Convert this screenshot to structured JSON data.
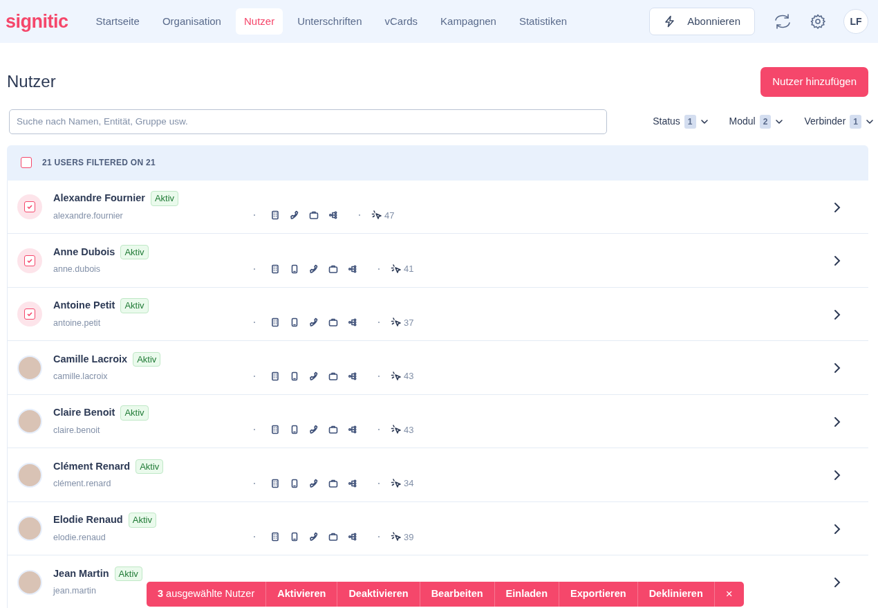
{
  "logo": "signitic",
  "nav_tabs": [
    {
      "label": "Startseite",
      "selected": false
    },
    {
      "label": "Organisation",
      "selected": false
    },
    {
      "label": "Nutzer",
      "selected": true
    },
    {
      "label": "Unterschriften",
      "selected": false
    },
    {
      "label": "vCards",
      "selected": false
    },
    {
      "label": "Kampagnen",
      "selected": false
    },
    {
      "label": "Statistiken",
      "selected": false
    }
  ],
  "subscribe_button": "Abonnieren",
  "user_avatar": "LF",
  "page_title": "Nutzer",
  "add_button": "Nutzer hinzufügen",
  "search": {
    "placeholder": "Suche nach Namen, Entität, Gruppe usw."
  },
  "filters": [
    {
      "label": "Status",
      "count": "1"
    },
    {
      "label": "Modul",
      "count": "2"
    },
    {
      "label": "Verbinder",
      "count": "1"
    }
  ],
  "list_header": {
    "label": "21 USERS FILTERED ON 21",
    "checked": false
  },
  "users": [
    {
      "name": "Alexandre Fournier",
      "status": "Aktiv",
      "email": "alexandre.fournier",
      "selected": true,
      "modules": [
        {
          "kind": "building"
        },
        {
          "kind": "phone"
        },
        {
          "kind": "briefcase"
        },
        {
          "kind": "tree"
        }
      ],
      "count": "47"
    },
    {
      "name": "Anne Dubois",
      "status": "Aktiv",
      "email": "anne.dubois",
      "selected": true,
      "modules": [
        {
          "kind": "building"
        },
        {
          "kind": "mobile"
        },
        {
          "kind": "phone"
        },
        {
          "kind": "briefcase"
        },
        {
          "kind": "tree"
        }
      ],
      "count": "41"
    },
    {
      "name": "Antoine Petit",
      "status": "Aktiv",
      "email": "antoine.petit",
      "selected": true,
      "modules": [
        {
          "kind": "building"
        },
        {
          "kind": "mobile"
        },
        {
          "kind": "phone"
        },
        {
          "kind": "briefcase"
        },
        {
          "kind": "tree"
        }
      ],
      "count": "37"
    },
    {
      "name": "Camille Lacroix",
      "status": "Aktiv",
      "email": "camille.lacroix",
      "selected": false,
      "modules": [
        {
          "kind": "building"
        },
        {
          "kind": "mobile"
        },
        {
          "kind": "phone"
        },
        {
          "kind": "briefcase"
        },
        {
          "kind": "tree"
        }
      ],
      "count": "43"
    },
    {
      "name": "Claire Benoit",
      "status": "Aktiv",
      "email": "claire.benoit",
      "selected": false,
      "modules": [
        {
          "kind": "building"
        },
        {
          "kind": "mobile"
        },
        {
          "kind": "phone"
        },
        {
          "kind": "briefcase"
        },
        {
          "kind": "tree"
        }
      ],
      "count": "43"
    },
    {
      "name": "Clément Renard",
      "status": "Aktiv",
      "email": "clément.renard",
      "selected": false,
      "modules": [
        {
          "kind": "building"
        },
        {
          "kind": "mobile"
        },
        {
          "kind": "phone"
        },
        {
          "kind": "briefcase"
        },
        {
          "kind": "tree"
        }
      ],
      "count": "34"
    },
    {
      "name": "Elodie Renaud",
      "status": "Aktiv",
      "email": "elodie.renaud",
      "selected": false,
      "modules": [
        {
          "kind": "building"
        },
        {
          "kind": "mobile"
        },
        {
          "kind": "phone"
        },
        {
          "kind": "briefcase"
        },
        {
          "kind": "tree"
        }
      ],
      "count": "39"
    },
    {
      "name": "Jean Martin",
      "status": "Aktiv",
      "email": "jean.martin",
      "selected": false
    }
  ],
  "action_bar": {
    "summary": "**3** ausgewählte Nutzer",
    "actions": [
      "Aktivieren",
      "Deaktivieren",
      "Bearbeiten",
      "Einladen",
      "Exportieren",
      "Deklinieren"
    ],
    "close": "×"
  }
}
